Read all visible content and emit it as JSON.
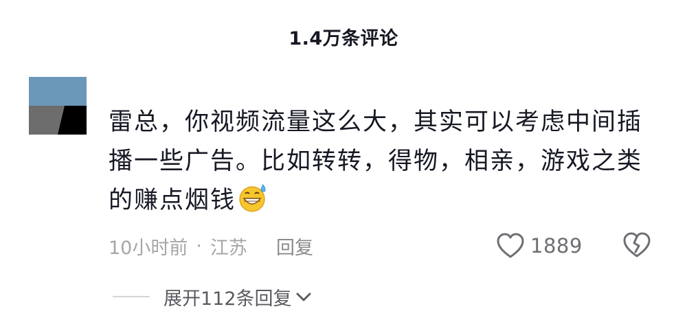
{
  "header": {
    "title": "1.4万条评论"
  },
  "comment": {
    "text": "雷总，你视频流量这么大，其实可以考虑中间插播一些广告。比如转转，得物，相亲，游戏之类的赚点烟钱",
    "emoji": "grinning-sweat-emoji",
    "time": "10小时前",
    "separator": "·",
    "location": "江苏",
    "reply_label": "回复",
    "like_count": "1889"
  },
  "replies": {
    "expand_label": "展开112条回复"
  },
  "colors": {
    "avatar_blue": "#6b97b8",
    "avatar_gray": "#6d6d6d",
    "avatar_black": "#000000",
    "text_primary": "#161823",
    "text_secondary": "#a6a6aa",
    "emoji_yellow": "#f7c52c"
  }
}
